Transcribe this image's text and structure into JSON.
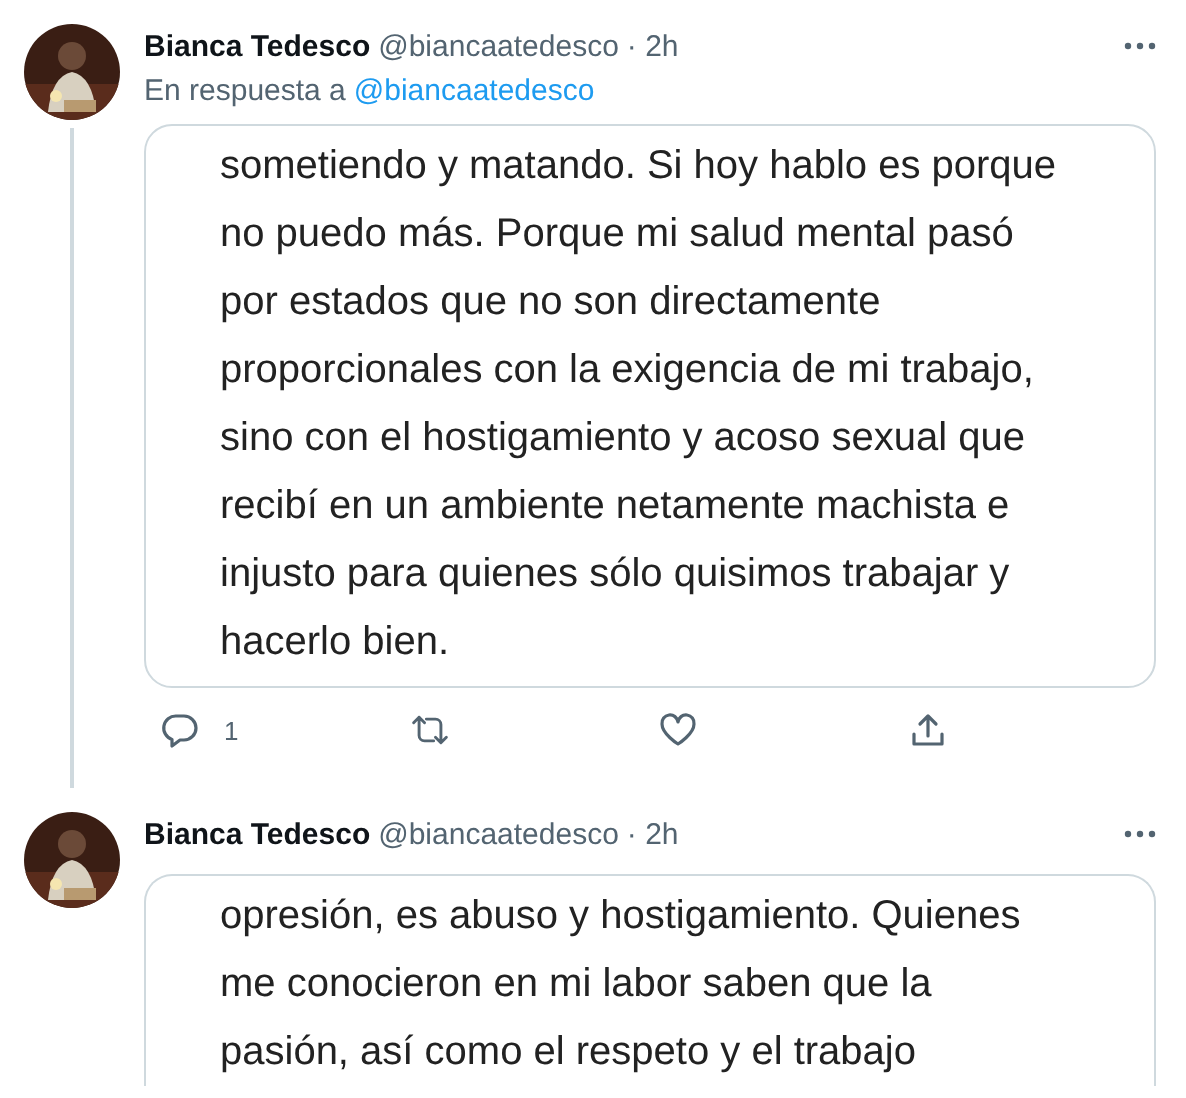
{
  "tweets": [
    {
      "author": "Bianca Tedesco",
      "handle": "@biancaatedesco",
      "time": "· 2h",
      "reply_to": {
        "prefix": "En respuesta a",
        "handle": "@biancaatedesco"
      },
      "thread_line": true,
      "image_lines": [
        "sometiendo y matando. Si hoy hablo es porque",
        "no puedo más. Porque mi salud mental pasó",
        "por estados que no son directamente",
        "proporcionales con la exigencia de mi trabajo,",
        "sino con el hostigamiento y acoso sexual que",
        "recibí en un ambiente netamente machista e",
        "injusto para quienes sólo quisimos trabajar y",
        "hacerlo bien."
      ],
      "actions": {
        "reply_count": "1"
      }
    },
    {
      "author": "Bianca Tedesco",
      "handle": "@biancaatedesco",
      "time": "· 2h",
      "thread_line": false,
      "image_lines": [
        "opresión, es abuso y hostigamiento. Quienes",
        "me conocieron en mi labor saben que la",
        "pasión, así como el respeto y el trabajo"
      ]
    }
  ]
}
